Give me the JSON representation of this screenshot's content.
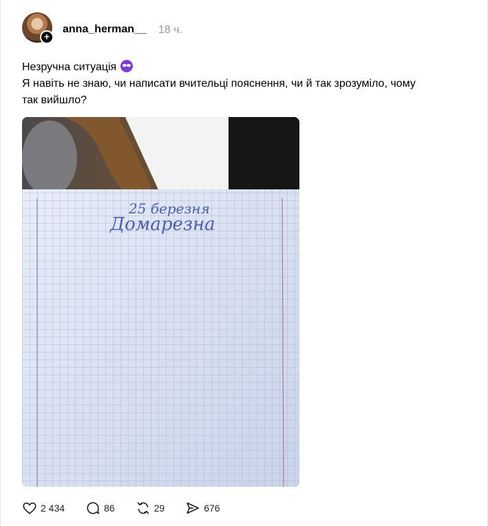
{
  "post": {
    "author": {
      "username": "anna_herman__",
      "time": "18 ч.",
      "avatar_icon": "user-avatar",
      "follow_icon": "plus-icon"
    },
    "text": {
      "line1": "Незручна ситуація",
      "emoji": "eyes-emoji",
      "line2": "Я навіть не знаю, чи написати вчительці пояснення, чи й так зрозуміло, чому",
      "line3": "так вийшло?"
    },
    "image": {
      "handwriting_date": "25 березня",
      "handwriting_title": "Домарезна"
    },
    "actions": {
      "likes": "2 434",
      "comments": "86",
      "reposts": "29",
      "shares": "676"
    }
  },
  "colors": {
    "text": "#000000",
    "muted": "#999999",
    "emoji": "#7c3fd1",
    "paper": "#dfe6f6",
    "grid": "#9fb0d0"
  }
}
